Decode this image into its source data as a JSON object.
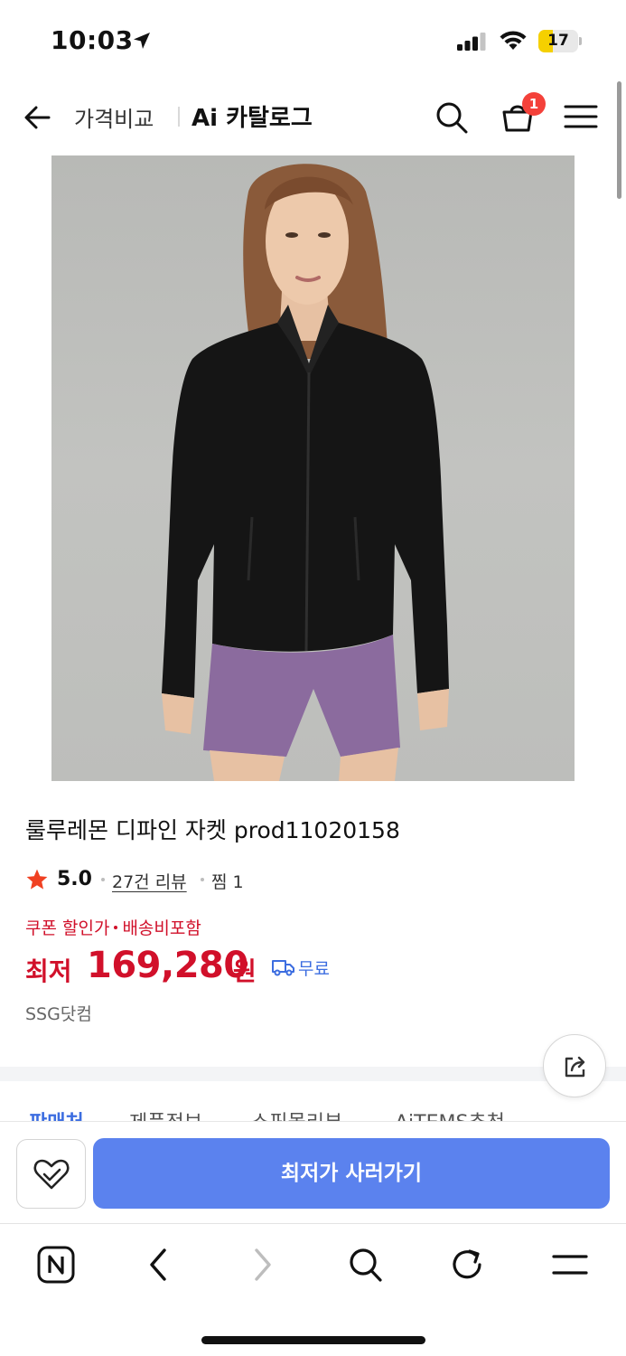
{
  "status_bar": {
    "time": "10:03",
    "battery_level": "17",
    "battery_color": "#f5d000"
  },
  "header": {
    "price_compare": "가격비교",
    "catalog_title": "Ai 카탈로그",
    "cart_count": "1",
    "icons": [
      "back-arrow-icon",
      "search-icon",
      "shopping-bag-icon",
      "menu-icon"
    ]
  },
  "product": {
    "title": "룰루레몬 디파인 자켓 prod11020158",
    "rating": "5.0",
    "reviews": "27건 리뷰",
    "wish": "찜 1",
    "coupon_label": "쿠폰 할인가",
    "shipping_included": "배송비포함",
    "price_prefix": "최저",
    "price": "169,280",
    "price_unit": "원",
    "free_shipping": "무료",
    "seller": "SSG닷컴"
  },
  "tabs": [
    "판매처",
    "제품정보",
    "쇼핑몰리뷰",
    "AiTEMS추천"
  ],
  "buy_bar": {
    "buy_label": "최저가 사러가기"
  },
  "colors": {
    "price_red": "#d1102a",
    "accent_blue": "#5b82ee",
    "link_blue": "#3c6de0",
    "badge_red": "#f4413a"
  }
}
